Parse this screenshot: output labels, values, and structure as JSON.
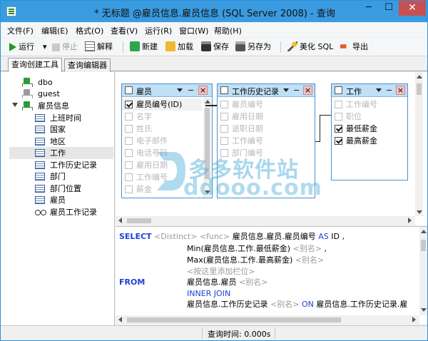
{
  "window": {
    "title": "* 无标题 @雇员信息.雇员信息 (SQL Server 2008) - 查询",
    "minimize": "─",
    "maximize": "☐",
    "close": "✕"
  },
  "menu": [
    "文件(F)",
    "编辑(E)",
    "格式(O)",
    "查看(V)",
    "运行(R)",
    "窗口(W)",
    "帮助(H)"
  ],
  "toolbar": {
    "run": "运行",
    "run_dropdown": "▾",
    "stop": "停止",
    "explain": "解释",
    "new": "新建",
    "load": "加载",
    "save": "保存",
    "save_as": "另存为",
    "beautify": "美化 SQL",
    "export": "导出"
  },
  "tabs": [
    "查询创建工具",
    "查询编辑器"
  ],
  "tree": {
    "nodes": [
      {
        "label": "dbo",
        "icon": "database-icon"
      },
      {
        "label": "guest",
        "icon": "database-icon-gray"
      },
      {
        "label": "雇员信息",
        "icon": "database-icon"
      }
    ],
    "tables": [
      "上班时间",
      "国家",
      "地区",
      "工作",
      "工作历史记录",
      "部门",
      "部门位置",
      "雇员"
    ],
    "views": [
      "雇员工作记录"
    ],
    "selected": "工作"
  },
  "diagram": {
    "tables": [
      {
        "name": "雇员",
        "fields": [
          "雇员编号(ID)",
          "名字",
          "姓氏",
          "电子邮件",
          "电话号码",
          "雇用日期",
          "工作编号",
          "薪金"
        ],
        "checked": [
          true,
          false,
          false,
          false,
          false,
          false,
          false,
          false
        ]
      },
      {
        "name": "工作历史记录",
        "fields": [
          "雇员编号",
          "雇用日期",
          "退职日期",
          "工作编号",
          "部门编号"
        ],
        "checked": [
          false,
          false,
          false,
          false,
          false
        ]
      },
      {
        "name": "工作",
        "fields": [
          "工作编号",
          "职位",
          "最低薪金",
          "最高薪金"
        ],
        "checked": [
          false,
          false,
          true,
          true
        ]
      }
    ],
    "header_menu": "▾",
    "header_min": "−",
    "header_close": "×"
  },
  "watermark": {
    "text": "多多软件站",
    "url": "ddooo.com"
  },
  "sql": {
    "select": "SELECT",
    "distinct": "<Distinct>",
    "func": "<func>",
    "col1": "雇员信息.雇员.雇员编号",
    "as": "AS",
    "alias1": "ID ,",
    "line2_a": "Min(雇员信息.工作.最低薪金)",
    "alias_ph": "<别名>",
    "line2_end": ",",
    "line3_a": "Max(雇员信息.工作.最高薪金)",
    "add_col": "<按这里添加栏位>",
    "from": "FROM",
    "table1": "雇员信息.雇员",
    "inner_join": "INNER JOIN",
    "table2": "雇员信息.工作历史记录",
    "on": "ON",
    "join_cond": "雇员信息.工作历史记录.雇"
  },
  "status": {
    "query_time": "查询时间: 0.000s"
  }
}
